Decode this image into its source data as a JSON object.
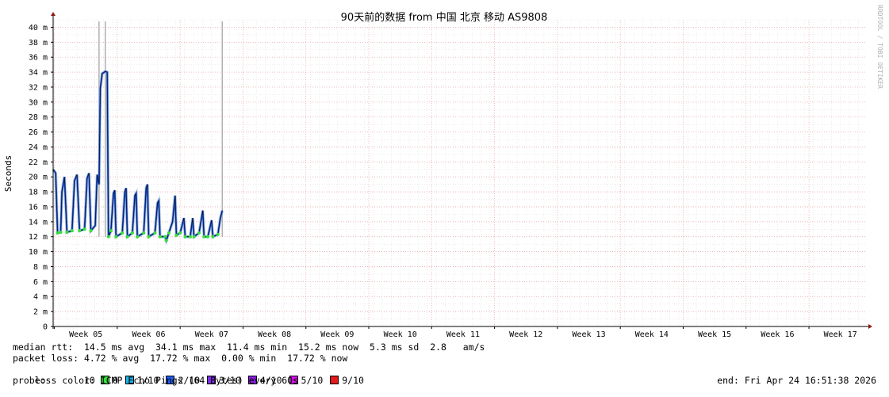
{
  "chart_data": {
    "type": "line",
    "title": "90天前的数据 from  中国 北京 移动 AS9808",
    "ylabel": "Seconds",
    "ylim": [
      0,
      41
    ],
    "yticks": [
      {
        "v": 0,
        "label": "0"
      },
      {
        "v": 2,
        "label": "2 m"
      },
      {
        "v": 4,
        "label": "4 m"
      },
      {
        "v": 6,
        "label": "6 m"
      },
      {
        "v": 8,
        "label": "8 m"
      },
      {
        "v": 10,
        "label": "10 m"
      },
      {
        "v": 12,
        "label": "12 m"
      },
      {
        "v": 14,
        "label": "14 m"
      },
      {
        "v": 16,
        "label": "16 m"
      },
      {
        "v": 18,
        "label": "18 m"
      },
      {
        "v": 20,
        "label": "20 m"
      },
      {
        "v": 22,
        "label": "22 m"
      },
      {
        "v": 24,
        "label": "24 m"
      },
      {
        "v": 26,
        "label": "26 m"
      },
      {
        "v": 28,
        "label": "28 m"
      },
      {
        "v": 30,
        "label": "30 m"
      },
      {
        "v": 32,
        "label": "32 m"
      },
      {
        "v": 34,
        "label": "34 m"
      },
      {
        "v": 36,
        "label": "36 m"
      },
      {
        "v": 38,
        "label": "38 m"
      },
      {
        "v": 40,
        "label": "40 m"
      }
    ],
    "xlim_weeks": [
      4.48,
      17.42
    ],
    "xticks": [
      {
        "w": 5,
        "label": "Week 05"
      },
      {
        "w": 6,
        "label": "Week 06"
      },
      {
        "w": 7,
        "label": "Week 07"
      },
      {
        "w": 8,
        "label": "Week 08"
      },
      {
        "w": 9,
        "label": "Week 09"
      },
      {
        "w": 10,
        "label": "Week 10"
      },
      {
        "w": 11,
        "label": "Week 11"
      },
      {
        "w": 12,
        "label": "Week 12"
      },
      {
        "w": 13,
        "label": "Week 13"
      },
      {
        "w": 14,
        "label": "Week 14"
      },
      {
        "w": 15,
        "label": "Week 15"
      },
      {
        "w": 16,
        "label": "Week 16"
      },
      {
        "w": 17,
        "label": "Week 17"
      }
    ],
    "grid": true,
    "series": [
      {
        "name": "median rtt",
        "unit": "ms",
        "points": [
          [
            4.48,
            21
          ],
          [
            4.52,
            20.5
          ],
          [
            4.55,
            12.5
          ],
          [
            4.6,
            12.6
          ],
          [
            4.62,
            18
          ],
          [
            4.66,
            20
          ],
          [
            4.7,
            12.6
          ],
          [
            4.78,
            12.8
          ],
          [
            4.82,
            19.5
          ],
          [
            4.86,
            20.3
          ],
          [
            4.9,
            12.8
          ],
          [
            4.98,
            13
          ],
          [
            5.02,
            19.8
          ],
          [
            5.05,
            20.5
          ],
          [
            5.08,
            12.8
          ],
          [
            5.15,
            13.5
          ],
          [
            5.18,
            20.3
          ],
          [
            5.21,
            19
          ],
          [
            5.23,
            31.8
          ],
          [
            5.26,
            33.8
          ],
          [
            5.31,
            34.1
          ],
          [
            5.34,
            34
          ],
          [
            5.36,
            12
          ],
          [
            5.4,
            12.8
          ],
          [
            5.44,
            17.8
          ],
          [
            5.46,
            18.2
          ],
          [
            5.48,
            12
          ],
          [
            5.58,
            12.5
          ],
          [
            5.62,
            18
          ],
          [
            5.64,
            18.5
          ],
          [
            5.66,
            12
          ],
          [
            5.74,
            12.5
          ],
          [
            5.78,
            17.5
          ],
          [
            5.8,
            17.8
          ],
          [
            5.82,
            12
          ],
          [
            5.92,
            12.5
          ],
          [
            5.96,
            18.5
          ],
          [
            5.98,
            19
          ],
          [
            6.0,
            12
          ],
          [
            6.1,
            12.5
          ],
          [
            6.14,
            16.5
          ],
          [
            6.16,
            16.8
          ],
          [
            6.18,
            12
          ],
          [
            6.26,
            12
          ],
          [
            6.28,
            11.5
          ],
          [
            6.32,
            12.5
          ],
          [
            6.38,
            14
          ],
          [
            6.42,
            17.5
          ],
          [
            6.44,
            12.2
          ],
          [
            6.5,
            12.5
          ],
          [
            6.56,
            14.5
          ],
          [
            6.58,
            12
          ],
          [
            6.66,
            12
          ],
          [
            6.7,
            14.5
          ],
          [
            6.72,
            12
          ],
          [
            6.8,
            12.5
          ],
          [
            6.86,
            15.5
          ],
          [
            6.88,
            12
          ],
          [
            6.94,
            12
          ],
          [
            7.0,
            14.2
          ],
          [
            7.02,
            12
          ],
          [
            7.1,
            12.3
          ],
          [
            7.14,
            14.5
          ],
          [
            7.17,
            15.5
          ]
        ]
      }
    ],
    "spikes_weeks": [
      5.21,
      5.31,
      7.17
    ],
    "loss_colors": [
      "#35e038",
      "#18b3ea",
      "#1d5ff2",
      "#7c2de6",
      "#8a1ee6",
      "#d614e8",
      "#e51b1b"
    ]
  },
  "watermark": "RRDTOOL / TOBI OETIKER",
  "stats": {
    "rtt_line": "median rtt:  14.5 ms avg  34.1 ms max  11.4 ms min  15.2 ms now  5.3 ms sd  2.8   am/s",
    "loss_line": "packet loss: 4.72 % avg  17.72 % max  0.00 % min  17.72 % now",
    "loss_label": "loss color: ",
    "loss_items": [
      {
        "label": "0",
        "color": "#35e038"
      },
      {
        "label": "1/10",
        "color": "#18b3ea"
      },
      {
        "label": "2/10",
        "color": "#1d5ff2"
      },
      {
        "label": "3/10",
        "color": "#7c2de6"
      },
      {
        "label": "4/10",
        "color": "#8a1ee6"
      },
      {
        "label": "5/10",
        "color": "#d614e8"
      },
      {
        "label": "9/10",
        "color": "#e51b1b"
      }
    ],
    "probe_line": "probe:       10 ICMP Echo Pings (64 Bytes) every 60s",
    "end_line": "end: Fri Apr 24 16:51:38 2026"
  }
}
